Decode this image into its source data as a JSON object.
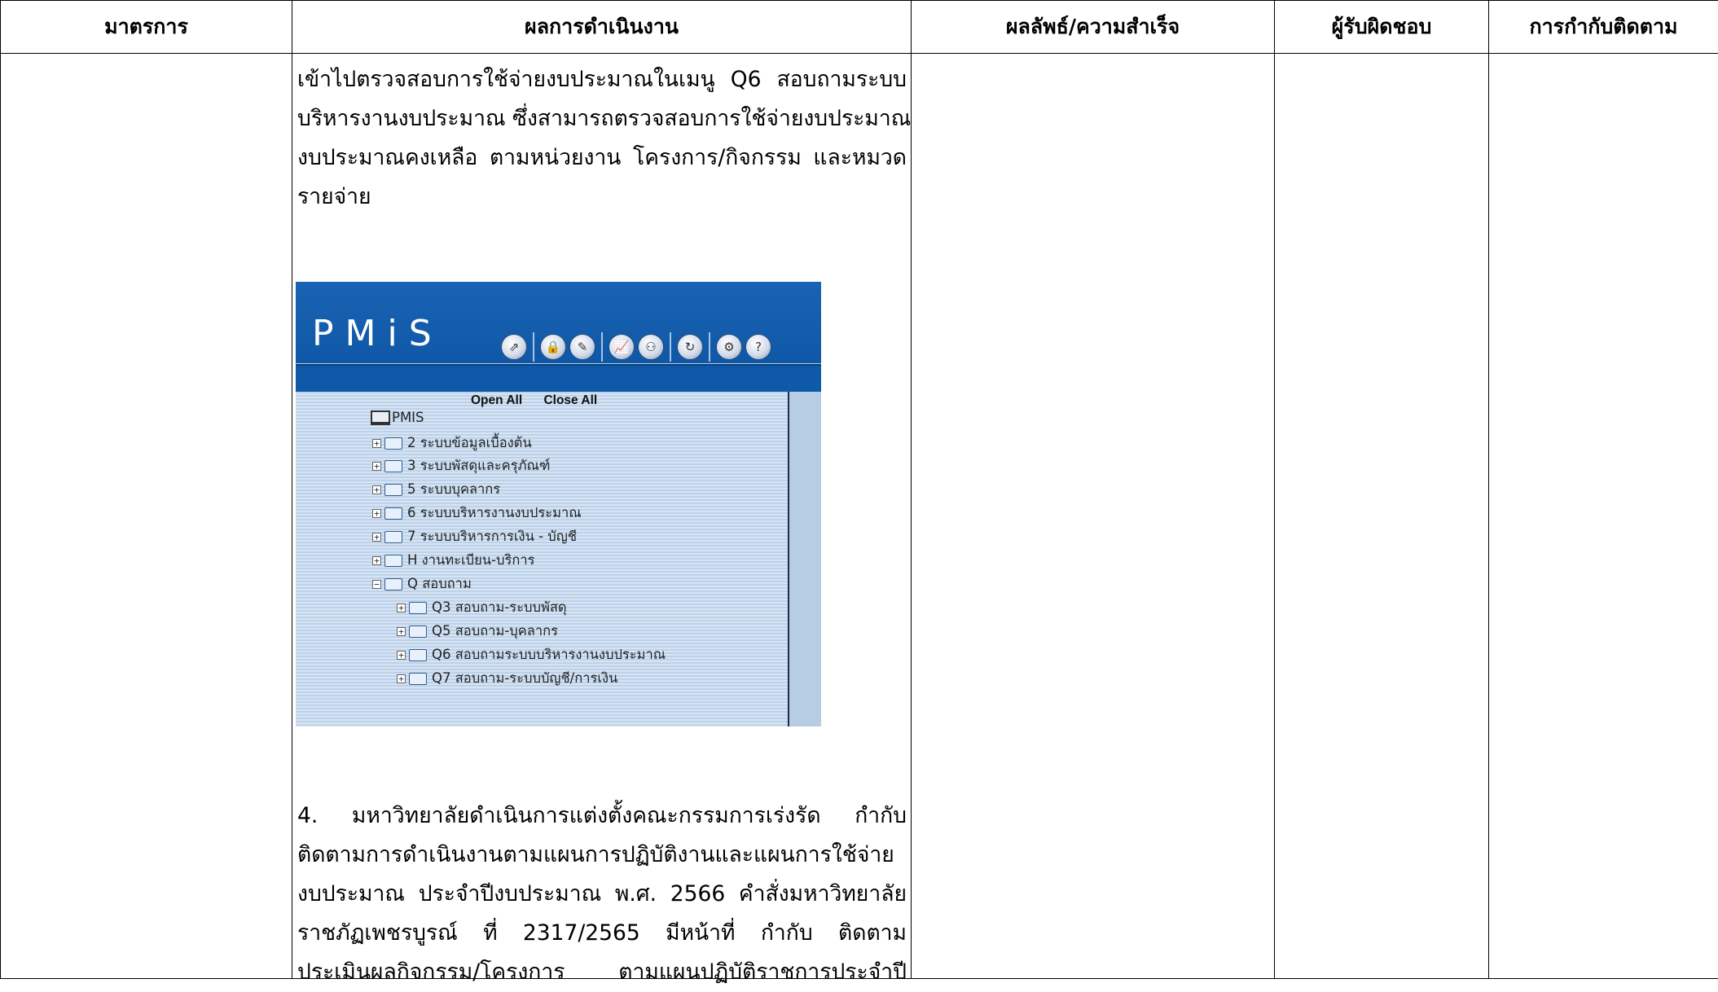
{
  "table": {
    "headers": [
      "มาตรการ",
      "ผลการดำเนินงาน",
      "ผลลัพธ์/ความสำเร็จ",
      "ผู้รับผิดชอบ",
      "การกำกับติดตาม"
    ]
  },
  "performance": {
    "para1_lines": [
      "เข้าไปตรวจสอบการใช้จ่ายงบประมาณในเมนู Q6 สอบถามระบบ",
      "บริหารงานงบประมาณ ซึ่งสามารถตรวจสอบการใช้จ่ายงบประมาณ",
      "งบประมาณคงเหลือ ตามหน่วยงาน โครงการ/กิจกรรม และหมวด",
      "รายจ่าย"
    ],
    "para2_lines": [
      "4. มหาวิทยาลัยดำเนินการแต่งตั้งคณะกรรมการเร่งรัด กำกับ",
      "ติดตามการดำเนินงานตามแผนการปฏิบัติงานและแผนการใช้จ่าย",
      "งบประมาณ ประจำปีงบประมาณ พ.ศ. 2566  คำสั่งมหาวิทยาลัย",
      "ราชภัฏเพชรบูรณ์ ที่ 2317/2565  มีหน้าที่ กำกับ ติดตาม",
      "ประเมินผลกิจกรรม/โครงการ ตามแผนปฏิบัติราชการประจำปี"
    ]
  },
  "pmis": {
    "logo": "PMiS",
    "open_all": "Open All",
    "close_all": "Close All",
    "root": "PMIS",
    "nodes": [
      {
        "label": "2 ระบบข้อมูลเบื้องต้น",
        "expanded": false
      },
      {
        "label": "3 ระบบพัสดุและครุภัณฑ์",
        "expanded": false
      },
      {
        "label": "5 ระบบบุคลากร",
        "expanded": false
      },
      {
        "label": "6 ระบบบริหารงานงบประมาณ",
        "expanded": false
      },
      {
        "label": "7 ระบบบริหารการเงิน - บัญชี",
        "expanded": false
      },
      {
        "label": "H งานทะเบียน-บริการ",
        "expanded": false
      },
      {
        "label": "Q สอบถาม",
        "expanded": true
      }
    ],
    "children": [
      {
        "label": "Q3 สอบถาม-ระบบพัสดุ"
      },
      {
        "label": "Q5 สอบถาม-บุคลากร"
      },
      {
        "label": "Q6 สอบถามระบบบริหารงานงบประมาณ"
      },
      {
        "label": "Q7 สอบถาม-ระบบบัญชี/การเงิน"
      }
    ],
    "toolbar_icons": [
      "folder-icon",
      "lock-icon",
      "tools-icon",
      "chart-icon",
      "org-icon",
      "refresh-icon",
      "settings-icon",
      "help-icon"
    ]
  }
}
